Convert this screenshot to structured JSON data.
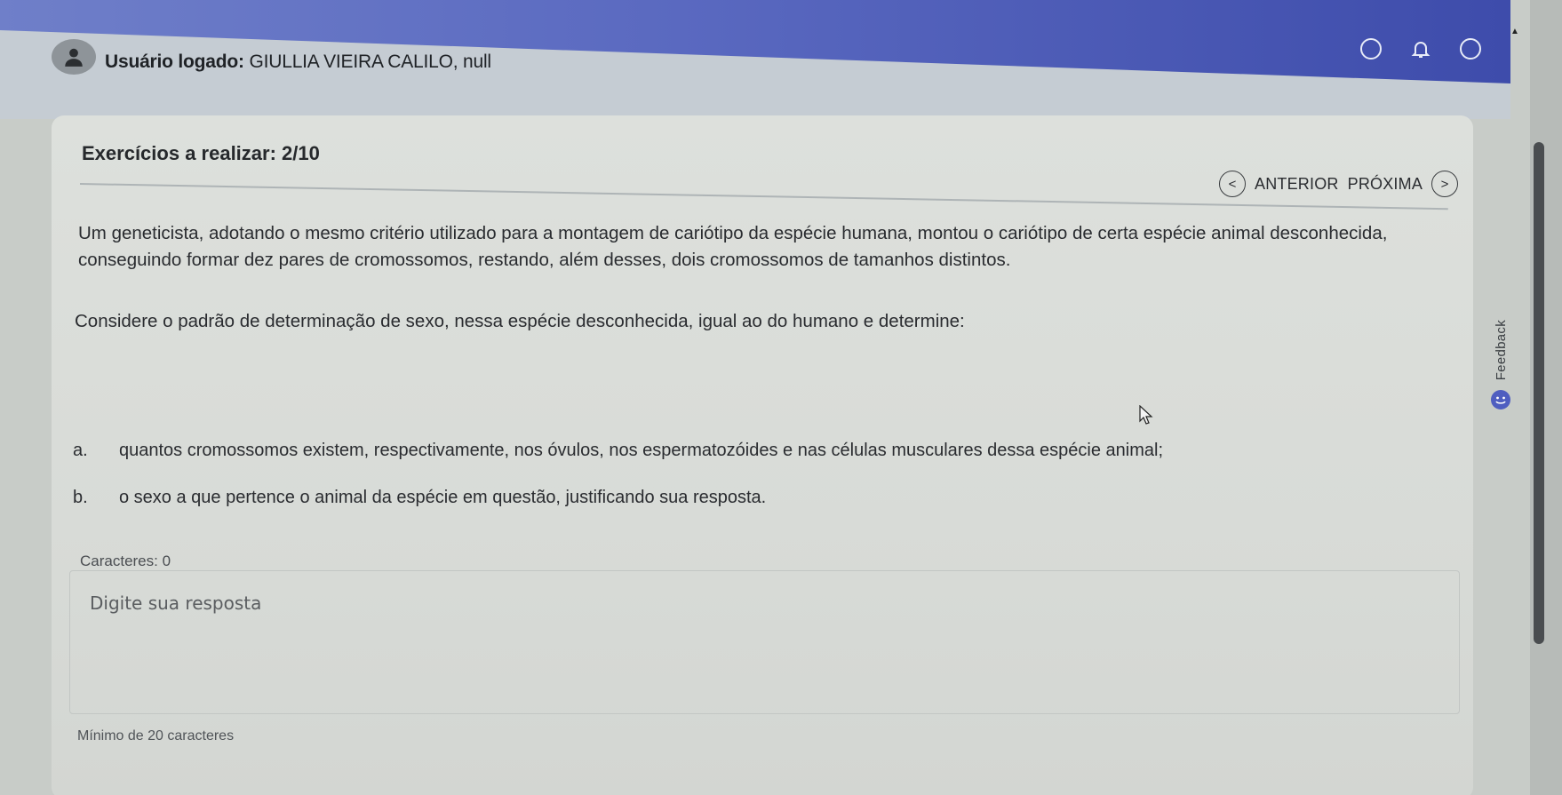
{
  "header": {
    "user_prefix": "Usuário logado:",
    "user_name": "GIULLIA VIEIRA CALILO, null"
  },
  "exercise": {
    "count_label": "Exercícios a realizar: 2/10"
  },
  "nav": {
    "prev_label": "ANTERIOR",
    "next_label": "PRÓXIMA",
    "prev_icon": "<",
    "next_icon": ">"
  },
  "question": {
    "paragraph_1": "Um geneticista, adotando o mesmo critério utilizado para a montagem de cariótipo da espécie humana, montou o cariótipo de certa espécie animal desconhecida, conseguindo formar dez pares de cromossomos, restando, além desses, dois cromossomos de tamanhos distintos.",
    "paragraph_2": "Considere o padrão de determinação de sexo, nessa espécie desconhecida, igual ao do humano e determine:",
    "items": [
      {
        "letter": "a.",
        "text": "quantos cromossomos existem, respectivamente, nos óvulos, nos espermatozóides e nas células musculares dessa espécie animal;"
      },
      {
        "letter": "b.",
        "text": "o sexo a que pertence o animal da espécie em questão, justificando sua resposta."
      }
    ]
  },
  "answer": {
    "chars_label": "Caracteres: 0",
    "placeholder": "Digite sua resposta",
    "value": "",
    "min_label": "Mínimo de 20 caracteres"
  },
  "feedback": {
    "label": "Feedback"
  },
  "colors": {
    "header_blue": "#5a69c0",
    "card_bg": "#dde0dc",
    "scroll_thumb": "#4a4d50"
  }
}
